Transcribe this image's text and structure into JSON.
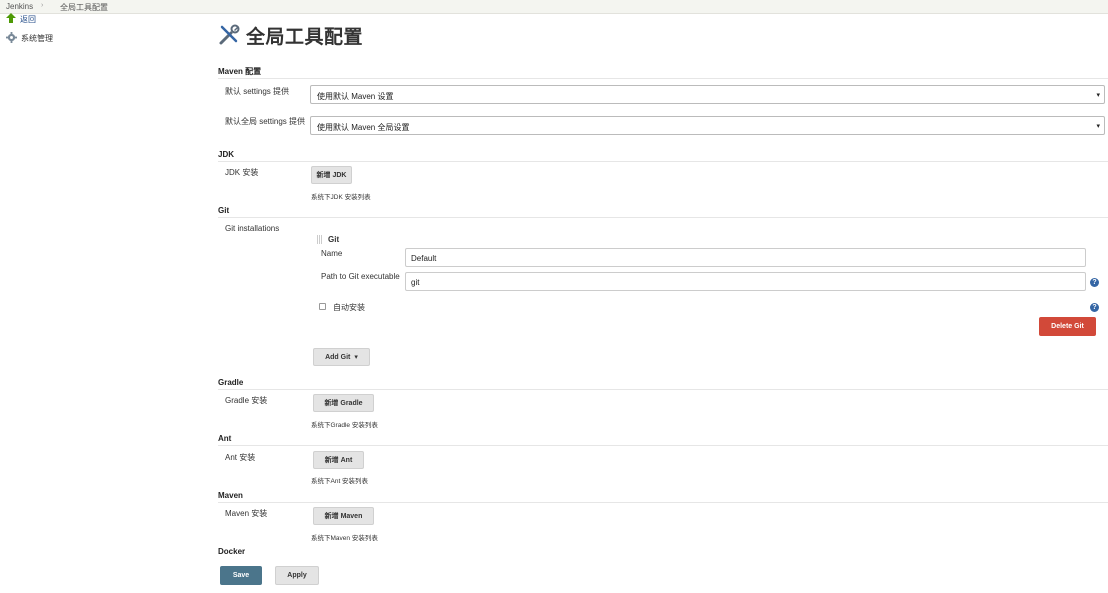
{
  "breadcrumb": {
    "root": "Jenkins",
    "separator": "›",
    "current": "全局工具配置"
  },
  "sidebar": {
    "items": [
      {
        "label": "返回",
        "icon": "up-arrow-icon"
      },
      {
        "label": "系统管理",
        "icon": "gear-icon"
      }
    ]
  },
  "page": {
    "title": "全局工具配置",
    "icon": "tools-icon"
  },
  "maven_config": {
    "heading": "Maven 配置",
    "settings_label": "默认 settings 提供",
    "settings_value": "使用默认 Maven 设置",
    "global_settings_label": "默认全局 settings 提供",
    "global_settings_value": "使用默认 Maven 全局设置"
  },
  "jdk": {
    "heading": "JDK",
    "label": "JDK 安装",
    "add_button": "新增 JDK",
    "note": "系统下JDK 安装列表"
  },
  "git": {
    "heading": "Git",
    "label": "Git installations",
    "entry_title": "Git",
    "name_label": "Name",
    "name_value": "Default",
    "path_label": "Path to Git executable",
    "path_value": "git",
    "auto_install_label": "自动安装",
    "auto_install_checked": false,
    "delete_button": "Delete Git",
    "add_button": "Add Git",
    "add_caret": "▾"
  },
  "gradle": {
    "heading": "Gradle",
    "label": "Gradle 安装",
    "add_button": "新增 Gradle",
    "note": "系统下Gradle 安装列表"
  },
  "ant": {
    "heading": "Ant",
    "label": "Ant 安装",
    "add_button": "新增 Ant",
    "note": "系统下Ant 安装列表"
  },
  "maven": {
    "heading": "Maven",
    "label": "Maven 安装",
    "add_button": "新增 Maven",
    "note": "系统下Maven 安装列表"
  },
  "docker": {
    "heading": "Docker"
  },
  "actions": {
    "save": "Save",
    "apply": "Apply"
  },
  "help_glyph": "?",
  "colors": {
    "save": "#4b758b",
    "delete": "#d24939",
    "help": "#3465a4"
  }
}
